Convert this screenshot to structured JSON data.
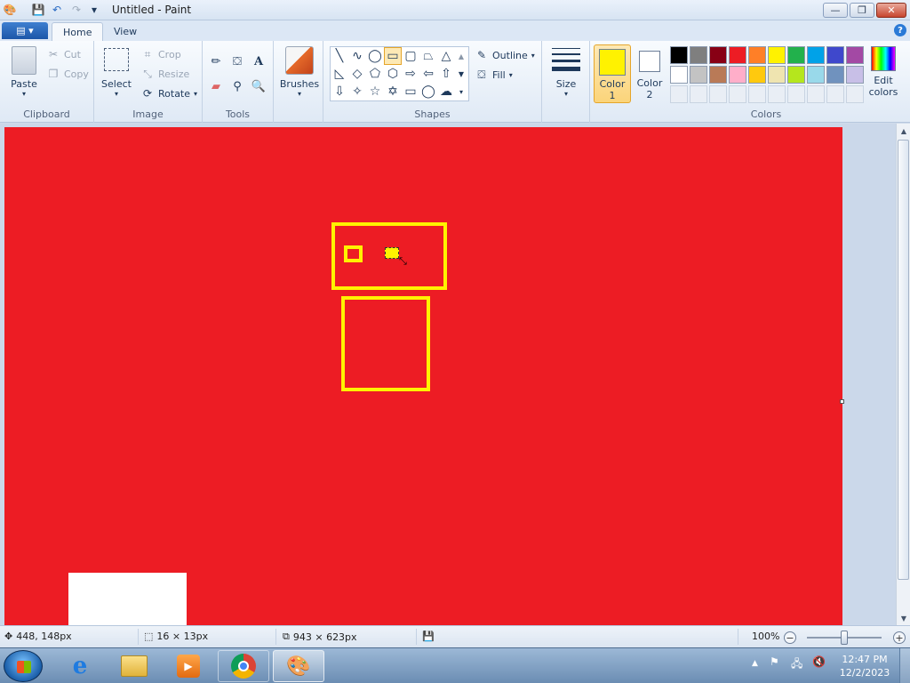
{
  "window": {
    "title": "Untitled - Paint",
    "minimize_glyph": "—",
    "maximize_glyph": "❐",
    "close_glyph": "✕"
  },
  "quick_access": {
    "app_icon": "paint-icon",
    "save_icon": "save-icon",
    "undo_icon": "undo-icon",
    "redo_icon": "redo-icon",
    "customize_glyph": "▾"
  },
  "tabs": {
    "file_glyph": "▤ ▾",
    "items": [
      "Home",
      "View"
    ],
    "help_glyph": "?"
  },
  "ribbon": {
    "clipboard": {
      "label": "Clipboard",
      "paste": "Paste",
      "cut": "Cut",
      "copy": "Copy"
    },
    "image": {
      "label": "Image",
      "select": "Select",
      "crop": "Crop",
      "resize": "Resize",
      "rotate": "Rotate"
    },
    "tools": {
      "label": "Tools",
      "text_glyph": "A"
    },
    "brushes": {
      "label": "Brushes"
    },
    "shapes": {
      "label": "Shapes",
      "outline": "Outline",
      "fill": "Fill"
    },
    "size": {
      "label": "Size"
    },
    "color1": {
      "label": "Color",
      "label2": "1",
      "value": "#fff200"
    },
    "color2": {
      "label": "Color",
      "label2": "2",
      "value": "#ffffff"
    },
    "colors": {
      "label": "Colors",
      "row1": [
        "#000000",
        "#7f7f7f",
        "#880015",
        "#ed1c24",
        "#ff7f27",
        "#fff200",
        "#22b14c",
        "#00a2e8",
        "#3f48cc",
        "#a349a4"
      ],
      "row2": [
        "#ffffff",
        "#c3c3c3",
        "#b97a57",
        "#ffaec9",
        "#ffc90e",
        "#efe4b0",
        "#b5e61d",
        "#99d9ea",
        "#7092be",
        "#c8bfe7"
      ]
    },
    "edit_colors": {
      "label": "Edit",
      "label2": "colors"
    }
  },
  "canvas": {
    "background": "#ed1c24",
    "shape_color": "#fff200"
  },
  "status": {
    "cursor_pos": "448, 148px",
    "selection_size": "16 × 13px",
    "image_size": "943 × 623px",
    "zoom": "100%"
  },
  "taskbar": {
    "time": "12:47 PM",
    "date": "12/2/2023"
  }
}
